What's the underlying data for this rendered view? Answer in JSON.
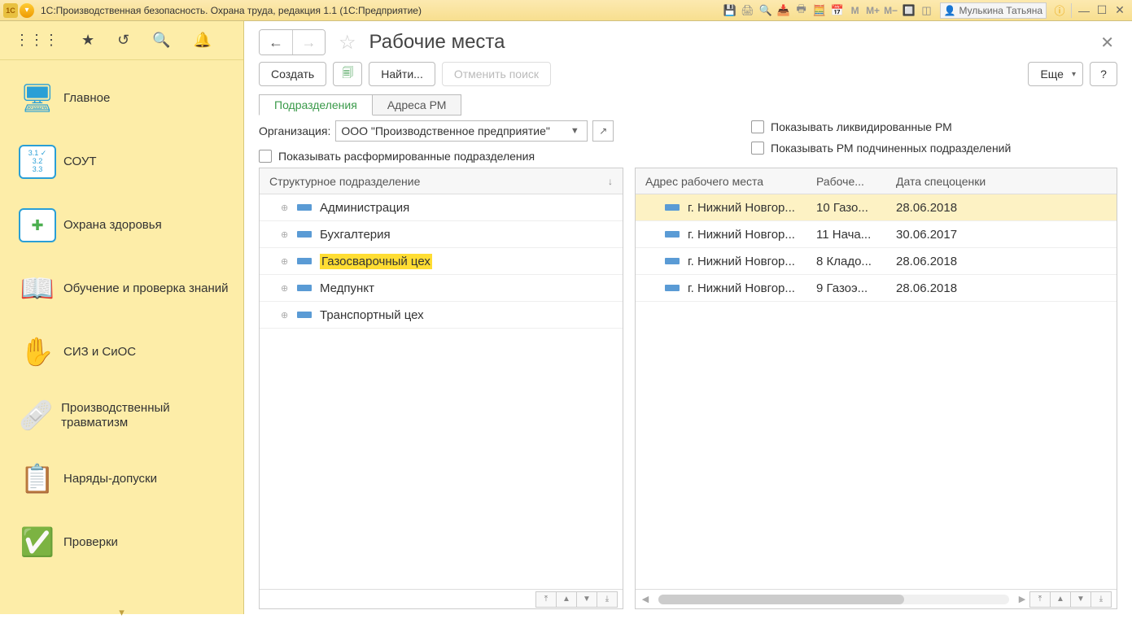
{
  "titlebar": {
    "app_title": "1С:Производственная безопасность. Охрана труда, редакция 1.1  (1С:Предприятие)",
    "user_name": "Мулькина Татьяна"
  },
  "sidebar": {
    "items": [
      {
        "label": "Главное"
      },
      {
        "label": "СОУТ"
      },
      {
        "label": "Охрана здоровья"
      },
      {
        "label": "Обучение и проверка знаний"
      },
      {
        "label": "СИЗ и СиОС"
      },
      {
        "label": "Производственный травматизм"
      },
      {
        "label": "Наряды-допуски"
      },
      {
        "label": "Проверки"
      }
    ]
  },
  "page": {
    "title": "Рабочие места",
    "toolbar": {
      "create": "Создать",
      "find": "Найти...",
      "cancel_search": "Отменить поиск",
      "more": "Еще"
    },
    "tabs": {
      "subdivisions": "Подразделения",
      "addresses": "Адреса РМ"
    },
    "filters": {
      "org_label": "Организация:",
      "org_value": "ООО \"Производственное предприятие\"",
      "show_disbanded": "Показывать расформированные подразделения",
      "show_liquidated": "Показывать ликвидированные РМ",
      "show_subordinate": "Показывать РМ подчиненных подразделений"
    },
    "left_panel": {
      "header": "Структурное подразделение",
      "rows": [
        {
          "label": "Администрация",
          "hl": false
        },
        {
          "label": "Бухгалтерия",
          "hl": false
        },
        {
          "label": "Газосварочный цех",
          "hl": true
        },
        {
          "label": "Медпункт",
          "hl": false
        },
        {
          "label": "Транспортный цех",
          "hl": false
        }
      ]
    },
    "right_panel": {
      "headers": {
        "address": "Адрес рабочего места",
        "work": "Рабоче...",
        "date": "Дата спецоценки"
      },
      "rows": [
        {
          "address": "г. Нижний Новгор...",
          "work": "10 Газо...",
          "date": "28.06.2018",
          "selected": true
        },
        {
          "address": "г. Нижний Новгор...",
          "work": "11 Нача...",
          "date": "30.06.2017",
          "selected": false
        },
        {
          "address": "г. Нижний Новгор...",
          "work": "8 Кладо...",
          "date": "28.06.2018",
          "selected": false
        },
        {
          "address": "г. Нижний Новгор...",
          "work": "9 Газоэ...",
          "date": "28.06.2018",
          "selected": false
        }
      ]
    }
  }
}
